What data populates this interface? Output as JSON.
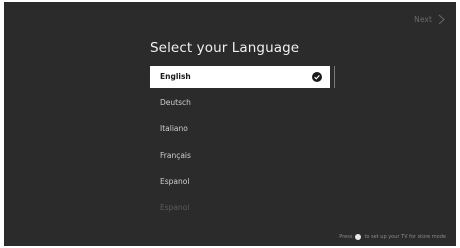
{
  "header": {
    "next_label": "Next"
  },
  "main": {
    "title": "Select your Language",
    "languages": [
      {
        "label": "English",
        "selected": true
      },
      {
        "label": "Deutsch",
        "selected": false
      },
      {
        "label": "Italiano",
        "selected": false
      },
      {
        "label": "Français",
        "selected": false
      },
      {
        "label": "Espanol",
        "selected": false
      },
      {
        "label": "Espanol",
        "selected": false
      }
    ]
  },
  "footer": {
    "hint_before": "Press",
    "hint_after": "to set up your TV for store mode"
  },
  "icons": {
    "next": "chevron-right-icon",
    "selected": "check-circle-icon",
    "hint": "dot-button-icon"
  },
  "colors": {
    "background": "#2b2b2b",
    "selected_background": "#ffffff",
    "text": "#cfcfcf"
  }
}
